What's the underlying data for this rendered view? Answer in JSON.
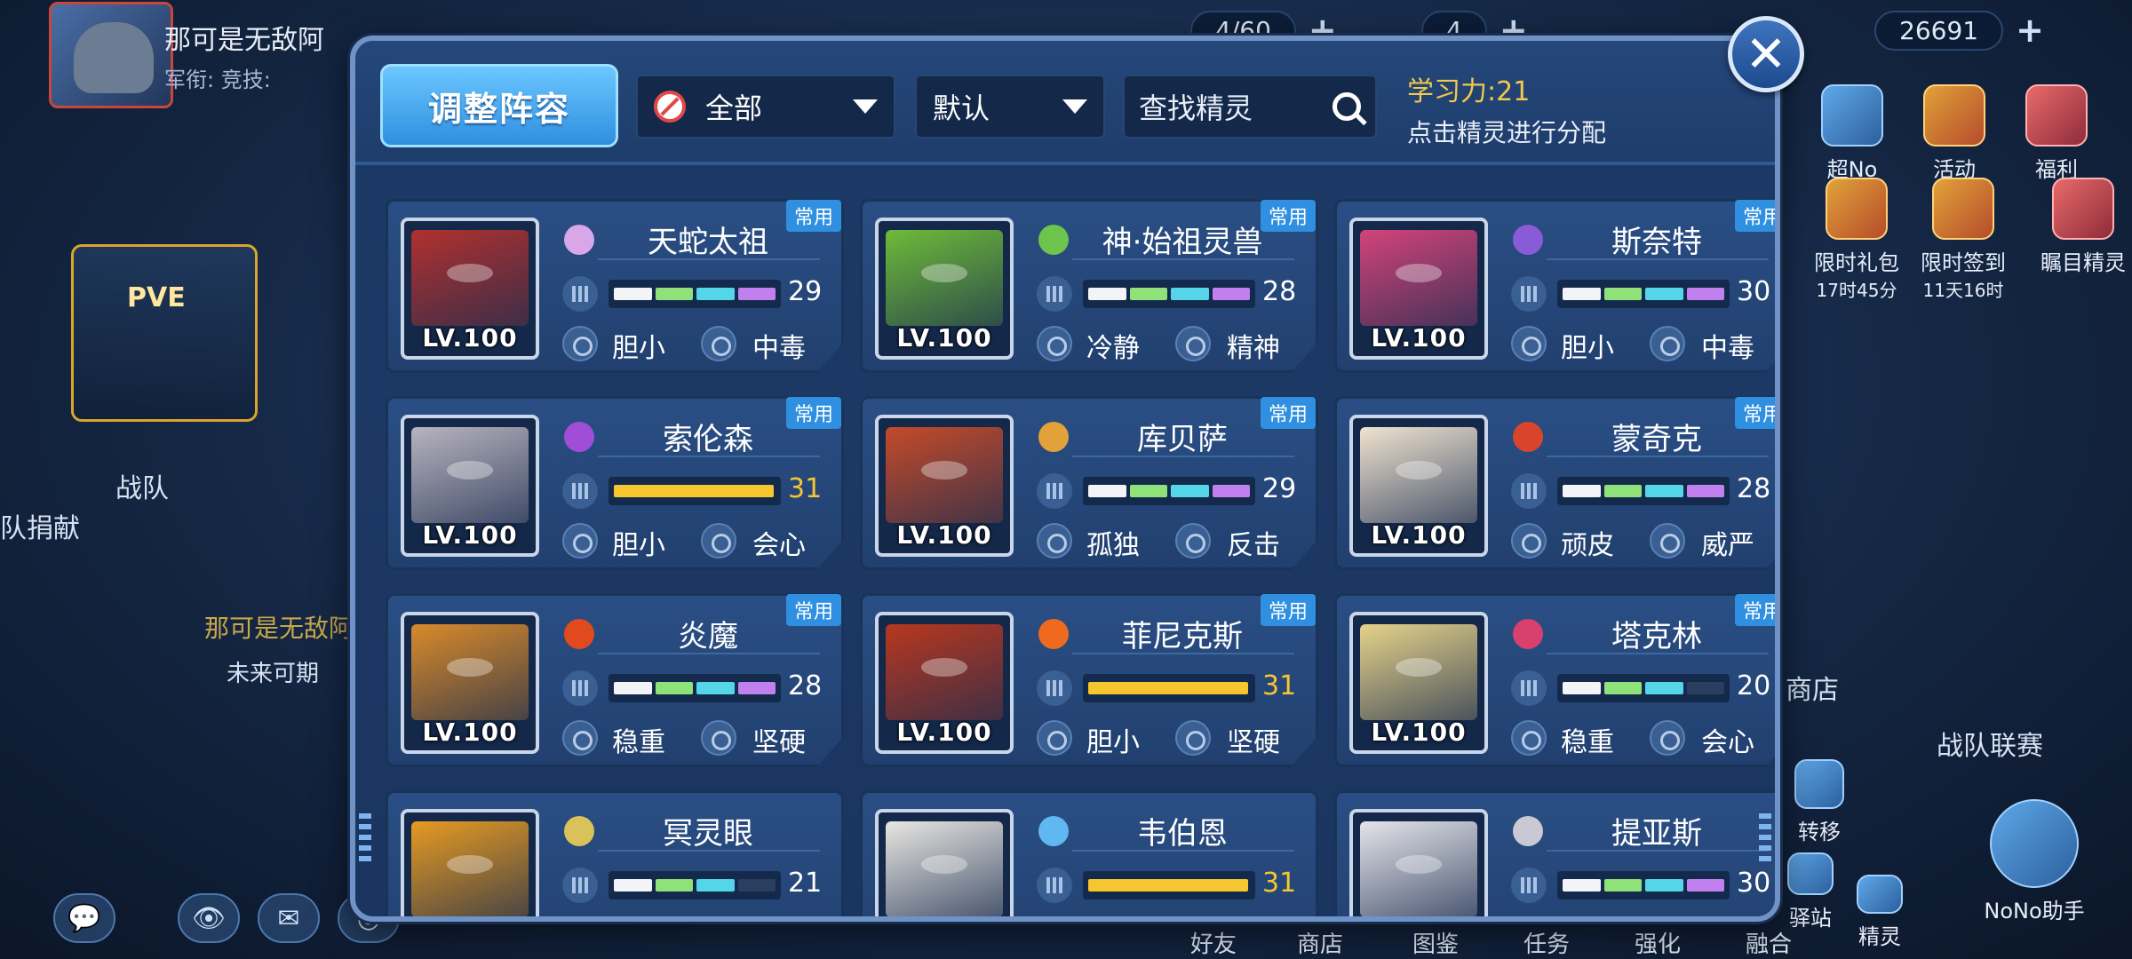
{
  "player": {
    "name": "那可是无敌阿",
    "subline": "军衔:    竞技:"
  },
  "resources": [
    {
      "value": "4/60"
    },
    {
      "value": "4"
    },
    {
      "value": "26691"
    }
  ],
  "right_buttons": [
    "超No",
    "活动",
    "福利",
    "限时礼包",
    "限时签到",
    "瞩目精灵"
  ],
  "right_timers": [
    "17时45分",
    "11天16时"
  ],
  "left_labels": {
    "pve": "PVE",
    "team": "战队",
    "donate": "队捐献",
    "future": "未来可期",
    "team_player": "那可是无敌阿"
  },
  "right_labels": {
    "shop": "商店",
    "league": "战队联赛",
    "transfer": "转移",
    "station": "驿站",
    "spirit": "精灵",
    "nono": "NoNo助手"
  },
  "bottom_tabs": [
    "好友",
    "商店",
    "图鉴",
    "任务",
    "强化",
    "融合"
  ],
  "modal": {
    "adjust_label": "调整阵容",
    "filter_all": "全部",
    "sort_default": "默认",
    "search_placeholder": "查找精灵",
    "learn_label": "学习力:21",
    "learn_hint": "点击精灵进行分配",
    "close": "✕"
  },
  "colors": {
    "accent": "#2f8fe0",
    "gold": "#f5c62f",
    "modal_border": "#6f93c6"
  },
  "spirits": [
    {
      "name": "天蛇太祖",
      "level": "LV.100",
      "badge": "常用",
      "stat": "29",
      "full": false,
      "segs": 4,
      "trait1": "胆小",
      "trait2": "中毒",
      "art": "#b0302f",
      "type": "#d9a7e8"
    },
    {
      "name": "神·始祖灵兽",
      "level": "LV.100",
      "badge": "常用",
      "stat": "28",
      "full": false,
      "segs": 4,
      "trait1": "冷静",
      "trait2": "精神",
      "art": "#6dbb3a",
      "type": "#6cc44c"
    },
    {
      "name": "斯奈特",
      "level": "LV.100",
      "badge": "常用",
      "stat": "30",
      "full": false,
      "segs": 4,
      "trait1": "胆小",
      "trait2": "中毒",
      "art": "#d2437a",
      "type": "#8a5bd6"
    },
    {
      "name": "索伦森",
      "level": "LV.100",
      "badge": "常用",
      "stat": "31",
      "full": true,
      "segs": 0,
      "trait1": "胆小",
      "trait2": "会心",
      "art": "#b8b3bf",
      "type": "#a04ed8"
    },
    {
      "name": "库贝萨",
      "level": "LV.100",
      "badge": "常用",
      "stat": "29",
      "full": false,
      "segs": 4,
      "trait1": "孤独",
      "trait2": "反击",
      "art": "#c44a2a",
      "type": "#e3a13a"
    },
    {
      "name": "蒙奇克",
      "level": "LV.100",
      "badge": "常用",
      "stat": "28",
      "full": false,
      "segs": 4,
      "trait1": "顽皮",
      "trait2": "威严",
      "art": "#efe3d0",
      "type": "#d8452a"
    },
    {
      "name": "炎魔",
      "level": "LV.100",
      "badge": "常用",
      "stat": "28",
      "full": false,
      "segs": 4,
      "trait1": "稳重",
      "trait2": "坚硬",
      "art": "#d88a2a",
      "type": "#e04a1e"
    },
    {
      "name": "菲尼克斯",
      "level": "LV.100",
      "badge": "常用",
      "stat": "31",
      "full": true,
      "segs": 0,
      "trait1": "胆小",
      "trait2": "坚硬",
      "art": "#b8371f",
      "type": "#ef6a1e"
    },
    {
      "name": "塔克林",
      "level": "LV.100",
      "badge": "常用",
      "stat": "20",
      "full": false,
      "segs": 3,
      "trait1": "稳重",
      "trait2": "会心",
      "art": "#e6d28a",
      "type": "#d8406e"
    },
    {
      "name": "冥灵眼",
      "level": "",
      "badge": "",
      "stat": "21",
      "full": false,
      "segs": 3,
      "trait1": "",
      "trait2": "",
      "art": "#e69a22",
      "type": "#d9c25a"
    },
    {
      "name": "韦伯恩",
      "level": "",
      "badge": "",
      "stat": "31",
      "full": true,
      "segs": 0,
      "trait1": "",
      "trait2": "",
      "art": "#e8e6e2",
      "type": "#5fb8f0"
    },
    {
      "name": "提亚斯",
      "level": "",
      "badge": "",
      "stat": "30",
      "full": false,
      "segs": 4,
      "trait1": "",
      "trait2": "",
      "art": "#e5e5ea",
      "type": "#c9c9d4"
    }
  ]
}
